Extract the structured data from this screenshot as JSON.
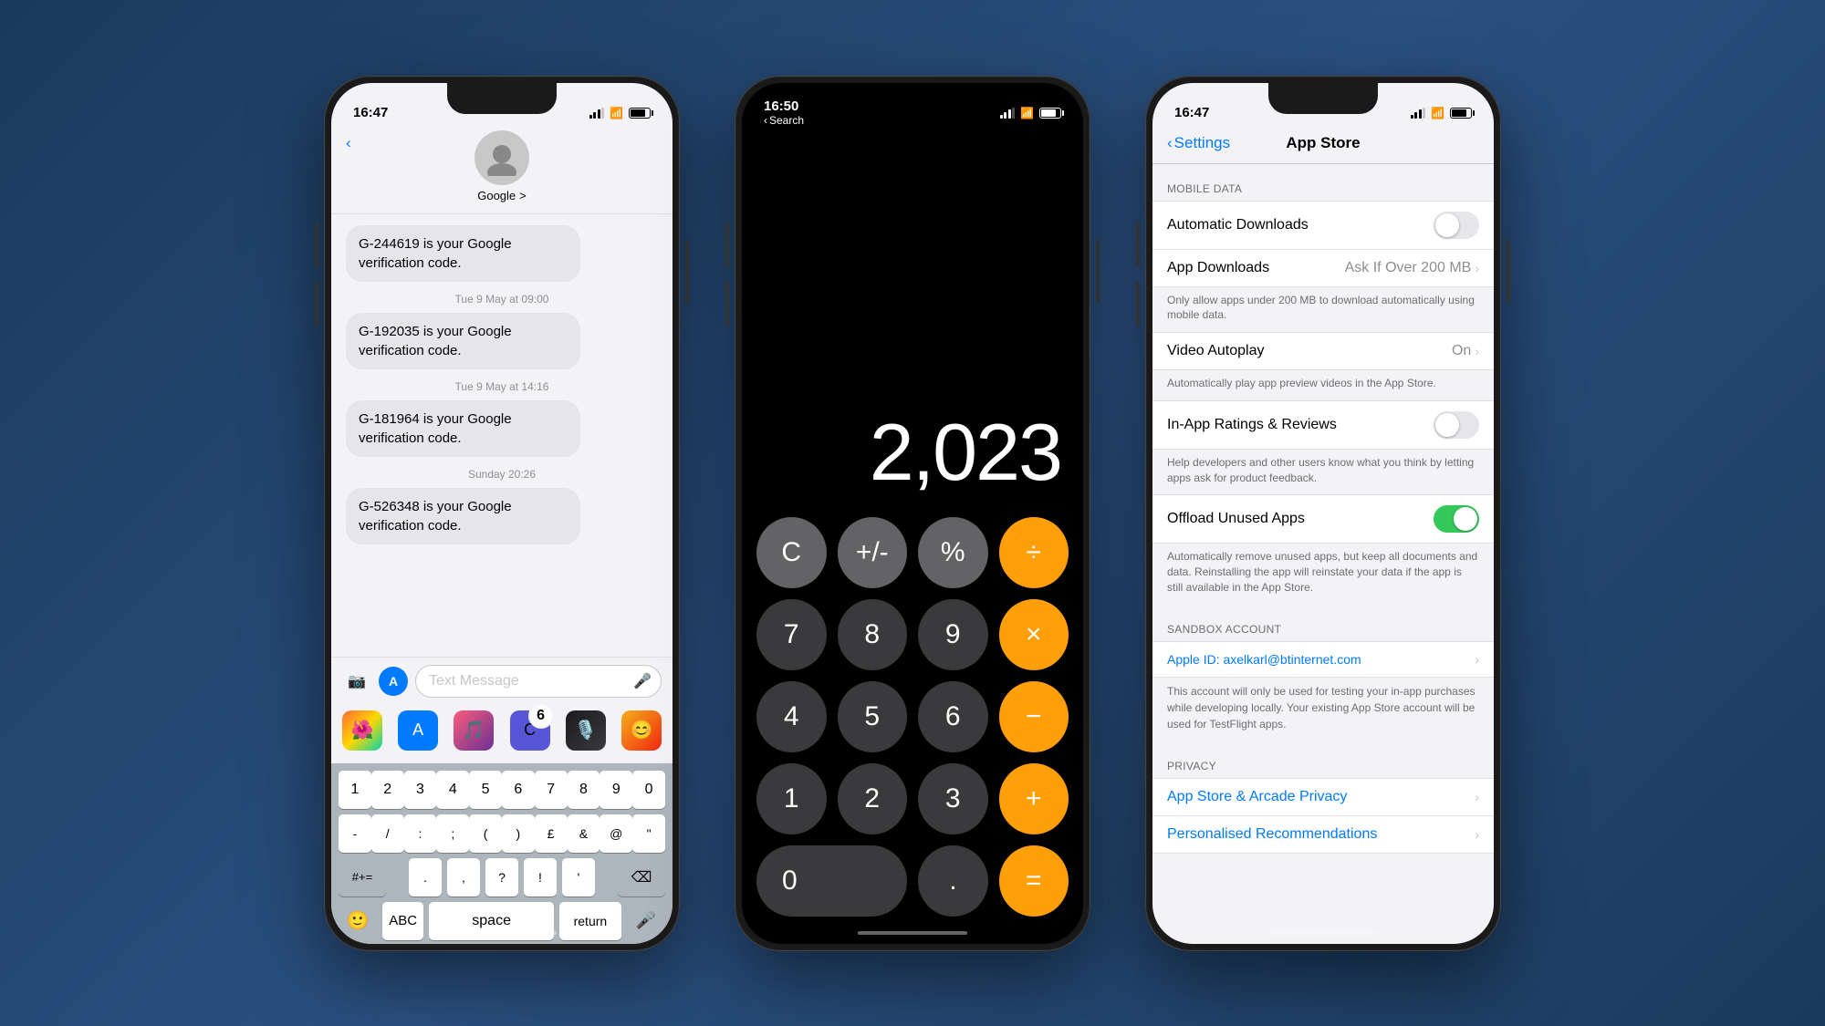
{
  "background": "#2a5080",
  "phone1": {
    "statusBar": {
      "time": "16:47",
      "signal": 3,
      "wifi": true,
      "battery": 85
    },
    "contact": "Google",
    "messages": [
      {
        "text": "G-244619 is your Google verification code.",
        "time": null
      },
      {
        "time": "Tue 9 May at 09:00",
        "text": null
      },
      {
        "text": "G-192035 is your Google verification code.",
        "time": null
      },
      {
        "time": "Tue 9 May at 14:16",
        "text": null
      },
      {
        "text": "G-181964 is your Google verification code.",
        "time": null
      },
      {
        "time": "Sunday 20:26",
        "text": null
      },
      {
        "text": "G-526348 is your Google verification code.",
        "time": null
      }
    ],
    "inputPlaceholder": "Text Message",
    "keyboard": {
      "numbers": [
        "1",
        "2",
        "3",
        "4",
        "5",
        "6",
        "7",
        "8",
        "9",
        "0"
      ],
      "symbols": [
        "-",
        "/",
        ":",
        ";",
        "(",
        ")",
        "£",
        "&",
        "@",
        "\""
      ],
      "special": "#+=",
      "bottom": [
        "ABC",
        "space",
        "return"
      ]
    },
    "badge": "6"
  },
  "phone2": {
    "statusBar": {
      "time": "16:50",
      "back": "Search",
      "signal": 3,
      "wifi": true,
      "battery": 85
    },
    "display": "2,023",
    "buttons": [
      [
        "C",
        "+/-",
        "%",
        "÷"
      ],
      [
        "7",
        "8",
        "9",
        "×"
      ],
      [
        "4",
        "5",
        "6",
        "−"
      ],
      [
        "1",
        "2",
        "3",
        "+"
      ],
      [
        "0",
        ".",
        "="
      ]
    ]
  },
  "phone3": {
    "statusBar": {
      "time": "16:47",
      "signal": 3,
      "wifi": true,
      "battery": 85
    },
    "backLabel": "Settings",
    "title": "App Store",
    "sections": {
      "mobileData": {
        "header": "MOBILE DATA",
        "items": [
          {
            "label": "Automatic Downloads",
            "type": "toggle",
            "value": false
          },
          {
            "label": "App Downloads",
            "type": "chevron",
            "value": "Ask If Over 200 MB"
          }
        ],
        "desc": "Only allow apps under 200 MB to download automatically using mobile data."
      },
      "videoAutoplay": {
        "label": "Video Autoplay",
        "type": "chevron",
        "value": "On",
        "desc": "Automatically play app preview videos in the App Store."
      },
      "inAppRatings": {
        "label": "In-App Ratings & Reviews",
        "type": "toggle",
        "value": false,
        "desc": "Help developers and other users know what you think by letting apps ask for product feedback."
      },
      "offloadApps": {
        "label": "Offload Unused Apps",
        "type": "toggle",
        "value": true,
        "desc": "Automatically remove unused apps, but keep all documents and data. Reinstalling the app will reinstate your data if the app is still available in the App Store."
      },
      "sandboxAccount": {
        "header": "SANDBOX ACCOUNT",
        "appleId": "Apple ID: axelkarl@btinternet.com",
        "desc": "This account will only be used for testing your in-app purchases while developing locally. Your existing App Store account will be used for TestFlight apps."
      },
      "privacy": {
        "header": "PRIVACY",
        "items": [
          {
            "label": "App Store & Arcade Privacy"
          },
          {
            "label": "Personalised Recommendations"
          }
        ]
      }
    }
  }
}
